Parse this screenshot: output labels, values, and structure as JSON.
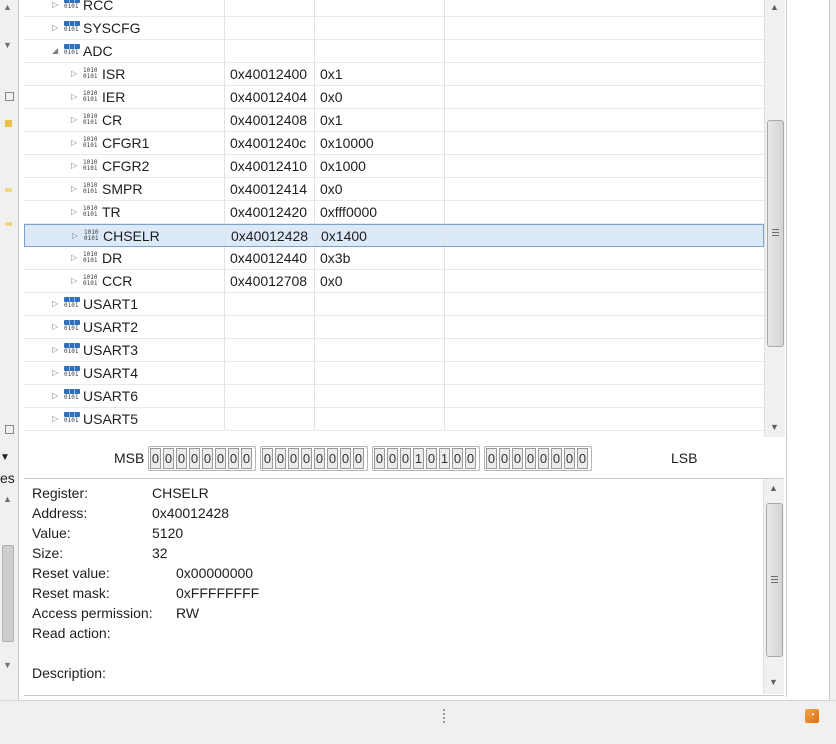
{
  "left_gutter": {
    "partial_text": "es"
  },
  "tree": {
    "rows": [
      {
        "name": "RCC",
        "level": 0,
        "kind": "peripheral",
        "expanded": false,
        "address": "",
        "value": ""
      },
      {
        "name": "SYSCFG",
        "level": 0,
        "kind": "peripheral",
        "expanded": false,
        "address": "",
        "value": ""
      },
      {
        "name": "ADC",
        "level": 0,
        "kind": "peripheral",
        "expanded": true,
        "address": "",
        "value": ""
      },
      {
        "name": "ISR",
        "level": 1,
        "kind": "register",
        "expanded": false,
        "address": "0x40012400",
        "value": "0x1"
      },
      {
        "name": "IER",
        "level": 1,
        "kind": "register",
        "expanded": false,
        "address": "0x40012404",
        "value": "0x0"
      },
      {
        "name": "CR",
        "level": 1,
        "kind": "register",
        "expanded": false,
        "address": "0x40012408",
        "value": "0x1"
      },
      {
        "name": "CFGR1",
        "level": 1,
        "kind": "register",
        "expanded": false,
        "address": "0x4001240c",
        "value": "0x10000"
      },
      {
        "name": "CFGR2",
        "level": 1,
        "kind": "register",
        "expanded": false,
        "address": "0x40012410",
        "value": "0x1000"
      },
      {
        "name": "SMPR",
        "level": 1,
        "kind": "register",
        "expanded": false,
        "address": "0x40012414",
        "value": "0x0"
      },
      {
        "name": "TR",
        "level": 1,
        "kind": "register",
        "expanded": false,
        "address": "0x40012420",
        "value": "0xfff0000"
      },
      {
        "name": "CHSELR",
        "level": 1,
        "kind": "register",
        "expanded": false,
        "address": "0x40012428",
        "value": "0x1400",
        "selected": true
      },
      {
        "name": "DR",
        "level": 1,
        "kind": "register",
        "expanded": false,
        "address": "0x40012440",
        "value": "0x3b"
      },
      {
        "name": "CCR",
        "level": 1,
        "kind": "register",
        "expanded": false,
        "address": "0x40012708",
        "value": "0x0"
      },
      {
        "name": "USART1",
        "level": 0,
        "kind": "peripheral",
        "expanded": false,
        "address": "",
        "value": ""
      },
      {
        "name": "USART2",
        "level": 0,
        "kind": "peripheral",
        "expanded": false,
        "address": "",
        "value": ""
      },
      {
        "name": "USART3",
        "level": 0,
        "kind": "peripheral",
        "expanded": false,
        "address": "",
        "value": ""
      },
      {
        "name": "USART4",
        "level": 0,
        "kind": "peripheral",
        "expanded": false,
        "address": "",
        "value": ""
      },
      {
        "name": "USART6",
        "level": 0,
        "kind": "peripheral",
        "expanded": false,
        "address": "",
        "value": ""
      },
      {
        "name": "USART5",
        "level": 0,
        "kind": "peripheral",
        "expanded": false,
        "address": "",
        "value": ""
      }
    ]
  },
  "bitfield": {
    "msb_label": "MSB",
    "lsb_label": "LSB",
    "bits": [
      "0",
      "0",
      "0",
      "0",
      "0",
      "0",
      "0",
      "0",
      "0",
      "0",
      "0",
      "0",
      "0",
      "0",
      "0",
      "0",
      "0",
      "0",
      "0",
      "1",
      "0",
      "1",
      "0",
      "0",
      "0",
      "0",
      "0",
      "0",
      "0",
      "0",
      "0",
      "0"
    ]
  },
  "details": {
    "register_label": "Register:",
    "register": "CHSELR",
    "address_label": "Address:",
    "address": "0x40012428",
    "value_label": "Value:",
    "value": "5120",
    "size_label": "Size:",
    "size": "32",
    "reset_value_label": "Reset value:",
    "reset_value": "0x00000000",
    "reset_mask_label": "Reset mask:",
    "reset_mask": "0xFFFFFFFF",
    "access_label": "Access permission:",
    "access": "RW",
    "read_action_label": "Read action:",
    "read_action": "",
    "description_label": "Description:",
    "description": ""
  },
  "colors": {
    "selection_bg": "#dce9f9",
    "selection_border": "#7da2ce",
    "peripheral_icon": "#2f6fc0",
    "rss": "#e46f0f"
  },
  "icons": {
    "expand": "triangle-right-icon",
    "collapse": "triangle-down-icon",
    "peripheral": "peripheral-icon",
    "register": "register-icon",
    "feed": "rss-icon"
  }
}
